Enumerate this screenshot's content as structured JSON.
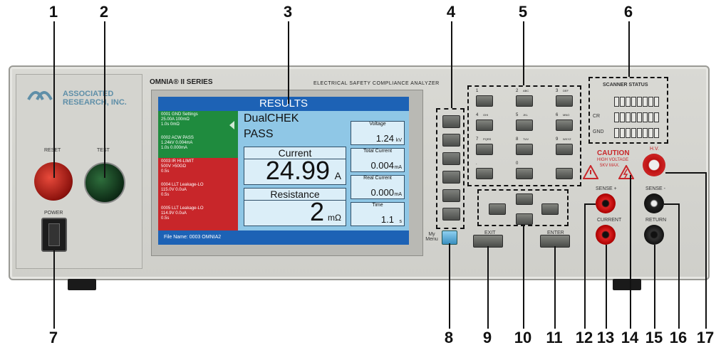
{
  "callouts": [
    "1",
    "2",
    "3",
    "4",
    "5",
    "6",
    "7",
    "8",
    "9",
    "10",
    "11",
    "12",
    "13",
    "14",
    "15",
    "16",
    "17"
  ],
  "brand": {
    "line1": "ASSOCIATED",
    "line2": "RESEARCH, INC.",
    "model": "OMNIA® II SERIES",
    "product": "ELECTRICAL SAFETY COMPLIANCE ANALYZER"
  },
  "left_panel": {
    "reset_label": "RESET",
    "test_label": "TEST",
    "power_label": "POWER"
  },
  "screen": {
    "title": "RESULTS",
    "steps": [
      {
        "line1": "0001 GND  Settings",
        "line2": "  25.00A   100mΩ",
        "line3": "  1.0s       0mΩ",
        "color": "#1f8b3e"
      },
      {
        "line1": "0002 ACW   PASS",
        "line2": "  1.24kV  0.004mA",
        "line3": "  1.0s   0.000mA",
        "color": "#1f8b3e"
      },
      {
        "line1": "0003 IR     HI-LIMIT",
        "line2": "  500V    >50GΩ",
        "line3": "  0.5s",
        "color": "#c8262a"
      },
      {
        "line1": "0004 LLT   Leakage-LO",
        "line2": "  115.0V  0.0uA",
        "line3": "  0.5s",
        "color": "#c8262a"
      },
      {
        "line1": "0005 LLT   Leakage-LO",
        "line2": "  114.9V  0.0uA",
        "line3": "  0.5s",
        "color": "#c8262a"
      }
    ],
    "test_name": "DualCHEK",
    "test_status": "PASS",
    "current_caption": "Current",
    "current_value": "24.99",
    "current_unit": "A",
    "resistance_caption": "Resistance",
    "resistance_value": "2",
    "resistance_unit": "mΩ",
    "voltage_caption": "Voltage",
    "voltage_value": "1.24",
    "voltage_unit": "kV",
    "total_current_caption": "Total Current",
    "total_current_value": "0.004",
    "total_current_unit": "mA",
    "real_current_caption": "Real Current",
    "real_current_value": "0.000",
    "real_current_unit": "mA",
    "time_caption": "Time",
    "time_value": "1.1",
    "time_unit": "s",
    "file_line": "File Name:   0003   OMNIA2"
  },
  "my_menu_label": "My Menu",
  "keypad": {
    "keys": [
      {
        "num": "1",
        "sub": ""
      },
      {
        "num": "2",
        "sub": "ABC"
      },
      {
        "num": "3",
        "sub": "DEF"
      },
      {
        "num": "4",
        "sub": "GHI"
      },
      {
        "num": "5",
        "sub": "JKL"
      },
      {
        "num": "6",
        "sub": "MNO"
      },
      {
        "num": "7",
        "sub": "PQRS"
      },
      {
        "num": "8",
        "sub": "TUV"
      },
      {
        "num": "9",
        "sub": "WXYZ"
      },
      {
        "num": ".",
        "sub": ""
      },
      {
        "num": "0",
        "sub": ""
      },
      {
        "num": "",
        "sub": ""
      }
    ]
  },
  "scanner": {
    "title": "SCANNER STATUS",
    "row_labels": [
      "",
      "CR",
      "GND"
    ]
  },
  "exit_label": "EXIT",
  "enter_label": "ENTER",
  "caution": {
    "title": "CAUTION",
    "line1": "HIGH VOLTAGE",
    "line2": "5KV  MAX."
  },
  "jacks": {
    "hv": "H.V.",
    "sense_plus": "SENSE +",
    "current": "CURRENT",
    "sense_minus": "SENSE -",
    "return": "RETURN"
  }
}
